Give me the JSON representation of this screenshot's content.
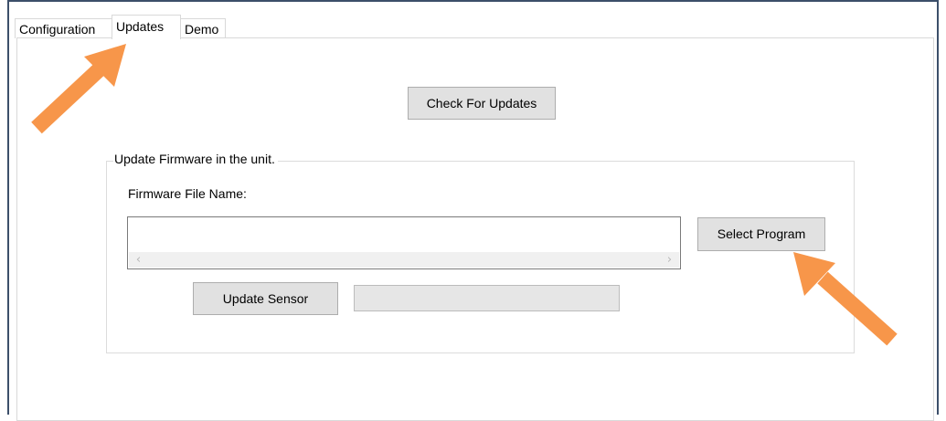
{
  "tabs": [
    {
      "label": "Configuration",
      "active": false
    },
    {
      "label": "Updates",
      "active": true
    },
    {
      "label": "Demo",
      "active": false
    }
  ],
  "main": {
    "check_updates_label": "Check For Updates"
  },
  "firmware_group": {
    "title": "Update Firmware in the unit.",
    "file_name_label": "Firmware File Name:",
    "file_name_value": "",
    "select_program_label": "Select Program",
    "update_sensor_label": "Update Sensor",
    "progress": 0
  },
  "annotations": {
    "arrow_color": "#f7964a"
  },
  "icons": {
    "scroll_left": "‹",
    "scroll_right": "›"
  }
}
